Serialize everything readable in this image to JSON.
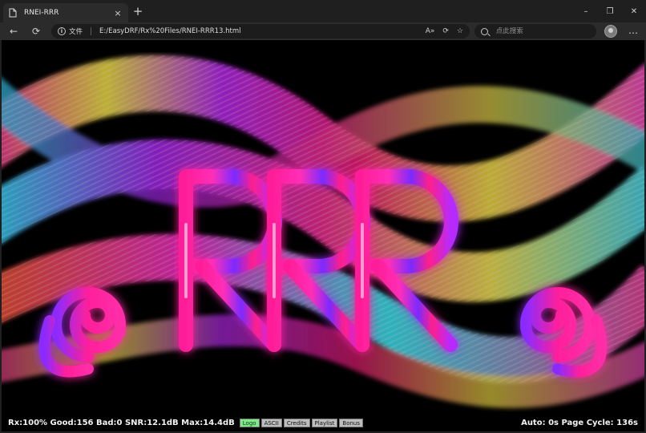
{
  "tab": {
    "title": "RNEI-RRR",
    "close": "×"
  },
  "new_tab": "+",
  "window_controls": {
    "minimize": "–",
    "restore": "❐",
    "close": "✕"
  },
  "nav": {
    "back": "←",
    "refresh": "⟳"
  },
  "address": {
    "label": "文件",
    "url": "E:/EasyDRF/Rx%20Files/RNEI-RRR13.html"
  },
  "search": {
    "placeholder": "点此搜索"
  },
  "more": "…",
  "status": {
    "left": "Rx:100% Good:156 Bad:0 SNR:12.1dB Max:14.4dB",
    "buttons": [
      "Logo",
      "ASCII",
      "Credits",
      "Playlist",
      "Bonus"
    ],
    "active_button": "Logo",
    "right": "Auto: 0s Page Cycle: 136s"
  },
  "logo": {
    "text": "RRR"
  },
  "colors": {
    "active_green": "#7ee88a",
    "magenta": "#ff1fa8",
    "violet": "#8a2cff",
    "cyan": "#35e6ff",
    "yellow": "#fff14a"
  }
}
